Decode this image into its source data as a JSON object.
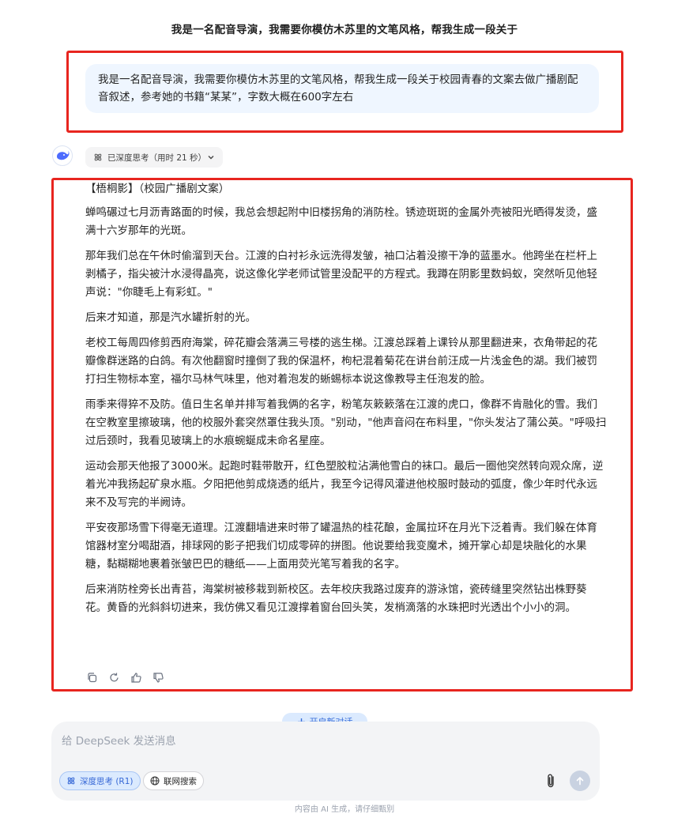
{
  "conversation": {
    "title": "我是一名配音导演，我需要你模仿木苏里的文笔风格，帮我生成一段关于"
  },
  "user_message": {
    "text": "我是一名配音导演，我需要你模仿木苏里的文笔风格，帮我生成一段关于校园青春的文案去做广播剧配音叙述，参考她的书籍“某某”，字数大概在600字左右"
  },
  "assistant": {
    "avatar_icon": "deepseek-whale-icon",
    "thinking_label": "已深度思考（用时 21 秒）",
    "heading": "【梧桐影】（校园广播剧文案）",
    "paragraphs": [
      "蝉鸣碾过七月沥青路面的时候，我总会想起附中旧楼拐角的消防栓。锈迹斑斑的金属外壳被阳光晒得发烫，盛满十六岁那年的光斑。",
      "那年我们总在午休时偷溜到天台。江渡的白衬衫永远洗得发皱，袖口沾着没擦干净的蓝墨水。他跨坐在栏杆上剥橘子，指尖被汁水浸得晶亮，说这像化学老师试管里没配平的方程式。我蹲在阴影里数蚂蚁，突然听见他轻声说：\"你睫毛上有彩虹。\"",
      "后来才知道，那是汽水罐折射的光。",
      "老校工每周四修剪西府海棠，碎花瓣会落满三号楼的逃生梯。江渡总踩着上课铃从那里翻进来，衣角带起的花瓣像群迷路的白鸽。有次他翻窗时撞倒了我的保温杯，枸杞混着菊花在讲台前汪成一片浅金色的湖。我们被罚打扫生物标本室，福尔马林气味里，他对着泡发的蜥蜴标本说这像教导主任泡发的脸。",
      "雨季来得猝不及防。值日生名单并排写着我俩的名字，粉笔灰簌簌落在江渡的虎口，像群不肯融化的雪。我们在空教室里擦玻璃，他的校服外套突然罩住我头顶。\"别动，\"他声音闷在布料里，\"你头发沾了蒲公英。\"呼吸扫过后颈时，我看见玻璃上的水痕蜿蜒成未命名星座。",
      "运动会那天他报了3000米。起跑时鞋带散开，红色塑胶粒沾满他雪白的袜口。最后一圈他突然转向观众席，逆着光冲我扬起矿泉水瓶。夕阳把他剪成烧透的纸片，我至今记得风灌进他校服时鼓动的弧度，像少年时代永远来不及写完的半阙诗。",
      "平安夜那场雪下得毫无道理。江渡翻墙进来时带了罐温热的桂花酿，金属拉环在月光下泛着青。我们躲在体育馆器材室分喝甜酒，排球网的影子把我们切成零碎的拼图。他说要给我变魔术，摊开掌心却是块融化的水果糖，黏糊糊地裹着张皱巴巴的糖纸——上面用荧光笔写着我的名字。",
      "后来消防栓旁长出青苔，海棠树被移栽到新校区。去年校庆我路过废弃的游泳馆，瓷砖缝里突然钻出株野葵花。黄昏的光斜斜切进来，我仿佛又看见江渡撑着窗台回头笑，发梢滴落的水珠把时光透出个小小的洞。"
    ],
    "actions": [
      "copy-icon",
      "regenerate-icon",
      "thumbs-up-icon",
      "thumbs-down-icon"
    ]
  },
  "new_chat": {
    "label": "开启新对话"
  },
  "composer": {
    "placeholder": "给 DeepSeek 发送消息",
    "deep_think_label": "深度思考 (R1)",
    "web_search_label": "联网搜索"
  },
  "footer": {
    "note": "内容由 AI 生成，请仔细甄别"
  },
  "colors": {
    "highlight_border": "#e8251f",
    "accent": "#3567d6",
    "user_bubble": "#eff6ff"
  }
}
